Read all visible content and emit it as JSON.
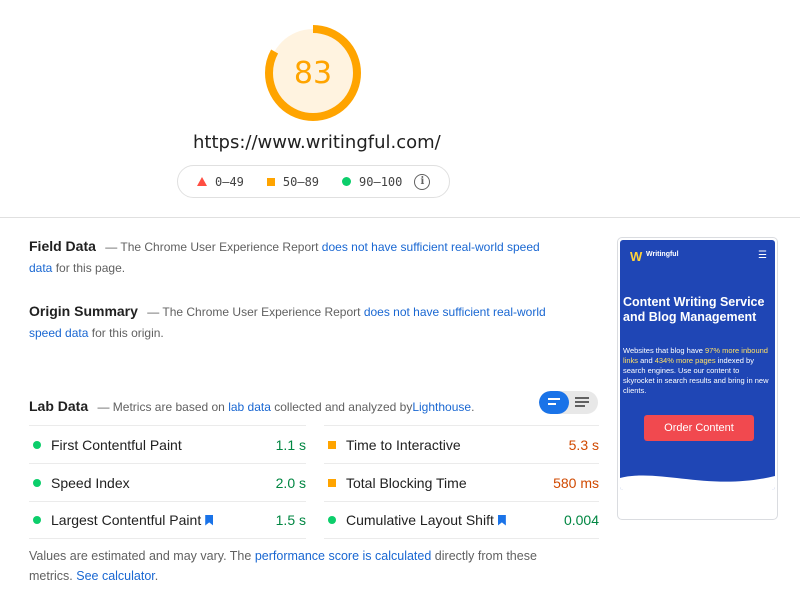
{
  "report": {
    "score": "83",
    "score_fraction": 0.83,
    "score_color": "#ffa400",
    "url": "https://www.writingful.com/"
  },
  "legend": {
    "items": [
      {
        "label": "0–49",
        "icon": "red-triangle-icon",
        "color": "#ff4e42"
      },
      {
        "label": "50–89",
        "icon": "orange-square-icon",
        "color": "#ffa400"
      },
      {
        "label": "90–100",
        "icon": "green-circle-icon",
        "color": "#0cce6b"
      }
    ],
    "info_icon": "info-icon"
  },
  "field_data": {
    "title": "Field Data",
    "prefix": "— The Chrome User Experience Report",
    "link": "does not have sufficient real-world speed data",
    "suffix": "for this page."
  },
  "origin_summary": {
    "title": "Origin Summary",
    "prefix": "— The Chrome User Experience Report",
    "link": "does not have sufficient real-world speed data",
    "suffix": "for this origin."
  },
  "lab_data": {
    "title": "Lab Data",
    "prefix": "— Metrics are based on",
    "link1": "lab data",
    "middle": "collected and analyzed by",
    "link2": "Lighthouse",
    "suffix": "."
  },
  "metrics": [
    {
      "name": "First Contentful Paint",
      "value": "1.1 s",
      "status": "good",
      "bookmark": false
    },
    {
      "name": "Time to Interactive",
      "value": "5.3 s",
      "status": "average",
      "bookmark": false
    },
    {
      "name": "Speed Index",
      "value": "2.0 s",
      "status": "good",
      "bookmark": false
    },
    {
      "name": "Total Blocking Time",
      "value": "580 ms",
      "status": "average",
      "bookmark": false
    },
    {
      "name": "Largest Contentful Paint",
      "value": "1.5 s",
      "status": "good",
      "bookmark": true
    },
    {
      "name": "Cumulative Layout Shift",
      "value": "0.004",
      "status": "good",
      "bookmark": true
    }
  ],
  "footnote": {
    "prefix": "Values are estimated and may vary. The",
    "link1": "performance score is calculated",
    "middle": "directly from these metrics.",
    "link2": "See calculator",
    "suffix": "."
  },
  "thumbnail": {
    "brand": "Writingful",
    "heading": "Content Writing Service and Blog Management",
    "body_1": "Websites that blog have",
    "body_hl1": "97% more inbound links",
    "body_2": "and",
    "body_hl2": "434% more pages",
    "body_3": "indexed by search engines. Use our content to skyrocket in search results and bring in new clients.",
    "cta": "Order Content"
  },
  "colors": {
    "good": "#0cce6b",
    "average": "#ffa400",
    "poor": "#ff4e42",
    "link": "#1967d2"
  }
}
